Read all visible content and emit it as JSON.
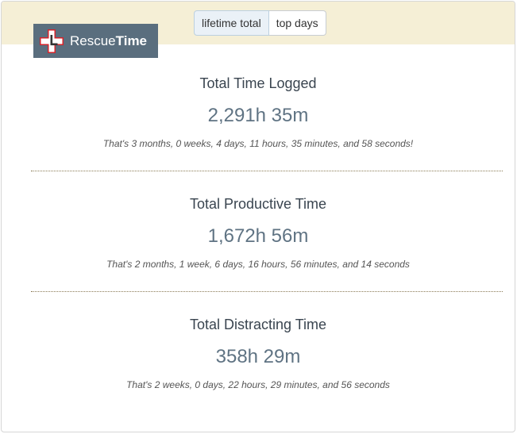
{
  "brand": {
    "name_light": "Rescue",
    "name_bold": "Time"
  },
  "tabs": [
    {
      "label": "lifetime total",
      "active": true
    },
    {
      "label": "top days",
      "active": false
    }
  ],
  "sections": [
    {
      "title": "Total Time Logged",
      "value": "2,291h 35m",
      "description": "That's 3 months, 0 weeks, 4 days, 11 hours, 35 minutes, and 58 seconds!"
    },
    {
      "title": "Total Productive Time",
      "value": "1,672h 56m",
      "description": "That's 2 months, 1 week, 6 days, 16 hours, 56 minutes, and 14 seconds"
    },
    {
      "title": "Total Distracting Time",
      "value": "358h 29m",
      "description": "That's 2 weeks, 0 days, 22 hours, 29 minutes, and 56 seconds"
    }
  ],
  "colors": {
    "header_band": "#f5efd6",
    "logo_bg": "#5a6e7e",
    "logo_red": "#d2232a",
    "value_text": "#5f7383"
  }
}
